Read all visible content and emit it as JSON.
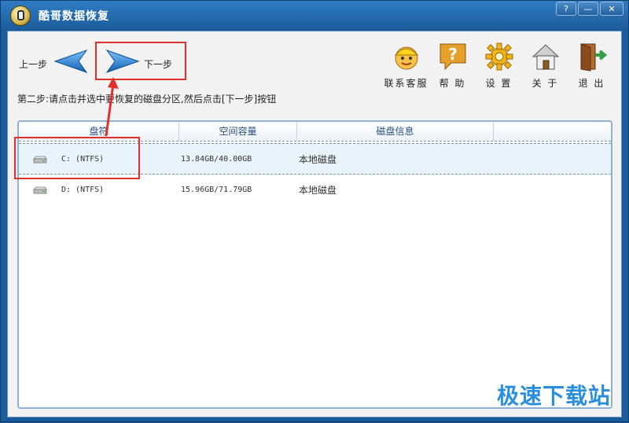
{
  "window": {
    "title": "酷哥数据恢复"
  },
  "window_controls": {
    "help": "?",
    "minimize": "—",
    "close": "✕"
  },
  "nav": {
    "prev_label": "上一步",
    "next_label": "下一步"
  },
  "toolbar": {
    "items": [
      {
        "label": "联系客服",
        "icon": "customer-service-icon"
      },
      {
        "label": "帮 助",
        "icon": "help-icon"
      },
      {
        "label": "设 置",
        "icon": "settings-gear-icon"
      },
      {
        "label": "关 于",
        "icon": "about-house-icon"
      },
      {
        "label": "退 出",
        "icon": "exit-door-icon"
      }
    ]
  },
  "instruction": "第二步:请点击并选中要恢复的磁盘分区,然后点击[下一步]按钮",
  "table": {
    "columns": [
      "盘符",
      "空间容量",
      "磁盘信息"
    ],
    "rows": [
      {
        "drive": "C: (NTFS)",
        "capacity": "13.84GB/40.00GB",
        "info": "本地磁盘"
      },
      {
        "drive": "D: (NTFS)",
        "capacity": "15.96GB/71.79GB",
        "info": "本地磁盘"
      }
    ]
  },
  "watermark": "极速下载站",
  "colors": {
    "title_bar": "#1b5b9a",
    "highlight_red": "#e0302c",
    "arrow_blue": "#1c7fd6"
  }
}
